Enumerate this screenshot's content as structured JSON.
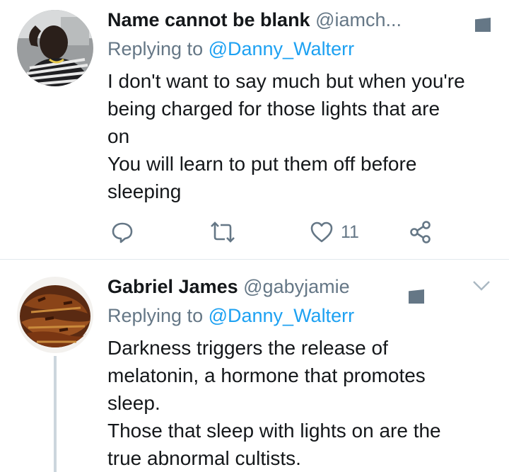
{
  "tweets": [
    {
      "name": "Name cannot be blank",
      "handle": "@iamch...",
      "replying_prefix": "Replying to ",
      "replying_to": "@Danny_Walterr",
      "text_lines": [
        "I don't want to say much but when you're",
        "being charged for those lights that are",
        "on",
        "You will learn to put them off before",
        "sleeping"
      ],
      "like_count": "11"
    },
    {
      "name": "Gabriel James",
      "handle": "@gabyjamie",
      "replying_prefix": "Replying to ",
      "replying_to": "@Danny_Walterr",
      "text_lines": [
        "Darkness triggers the release of",
        "melatonin, a hormone that promotes",
        "sleep.",
        "Those that sleep with lights on are the",
        "true abnormal cultists."
      ]
    }
  ],
  "icons": {
    "reply": "reply-icon",
    "retweet": "retweet-icon",
    "like": "heart-icon",
    "share": "share-icon",
    "more": "chevron-down-icon"
  },
  "colors": {
    "name": "#14171a",
    "secondary": "#657786",
    "link": "#1da1f2",
    "divider": "#e1e8ed"
  }
}
